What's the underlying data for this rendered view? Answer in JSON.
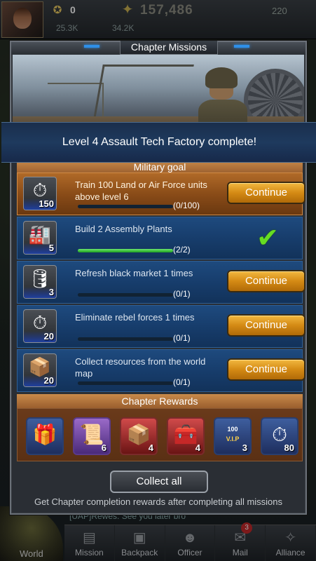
{
  "hud": {
    "rank_value": "0",
    "power_value": "157,486",
    "gold_value": "220",
    "resource1": "25.3K",
    "resource2": "34.2K",
    "chat_text": "[UAP]Rewes: See you later bro"
  },
  "dialog": {
    "title": "Chapter Missions",
    "notice": "Level 4 Assault Tech Factory complete!",
    "military_header": "Military goal",
    "continue_label": "Continue",
    "missions": [
      {
        "text": "Train 100 Land or Air Force units above level 6",
        "count": "(0/100)",
        "progress": 0,
        "icon": "stopwatch-icon",
        "icon_num": "150",
        "state": "active"
      },
      {
        "text": "Build 2 Assembly Plants",
        "count": "(2/2)",
        "progress": 1,
        "icon": "assembly-plant-icon",
        "icon_num": "5",
        "state": "done"
      },
      {
        "text": "Refresh black market 1 times",
        "count": "(0/1)",
        "progress": 0,
        "icon": "supply-barrel-icon",
        "icon_num": "3",
        "state": "open"
      },
      {
        "text": "Eliminate rebel forces 1 times",
        "count": "(0/1)",
        "progress": 0,
        "icon": "stopwatch-icon",
        "icon_num": "20",
        "state": "open"
      },
      {
        "text": "Collect resources from the world map",
        "count": "(0/1)",
        "progress": 0,
        "icon": "supply-crate-icon",
        "icon_num": "20",
        "state": "open"
      }
    ],
    "rewards_header": "Chapter Rewards",
    "rewards": [
      {
        "icon": "treasure-chest-icon",
        "num": "",
        "style": "blue"
      },
      {
        "icon": "document-chest-icon",
        "num": "6",
        "style": "purple"
      },
      {
        "icon": "ammo-crate-icon",
        "num": "4",
        "style": "red"
      },
      {
        "icon": "weapon-crate-icon",
        "num": "4",
        "style": "red"
      },
      {
        "icon": "vip-medal-icon",
        "num": "3",
        "style": "blue",
        "medal_text": "100",
        "medal_sub": "V.I.P"
      },
      {
        "icon": "stopwatch-icon",
        "num": "80",
        "style": "blue"
      }
    ],
    "collect_label": "Collect all",
    "footer_note": "Get Chapter completion rewards after completing all missions"
  },
  "nav": {
    "world": "World",
    "items": [
      {
        "label": "Mission",
        "icon": "mission-icon",
        "badge": ""
      },
      {
        "label": "Backpack",
        "icon": "backpack-icon",
        "badge": ""
      },
      {
        "label": "Officer",
        "icon": "officer-icon",
        "badge": ""
      },
      {
        "label": "Mail",
        "icon": "mail-icon",
        "badge": "3"
      },
      {
        "label": "Alliance",
        "icon": "alliance-icon",
        "badge": ""
      }
    ]
  },
  "colors": {
    "mission_blue": "#1e4a7e",
    "mission_active": "#b06a28",
    "continue_gold": "#d48a14",
    "progress_green": "#1ea01e",
    "header_orange": "#c88a4a"
  }
}
